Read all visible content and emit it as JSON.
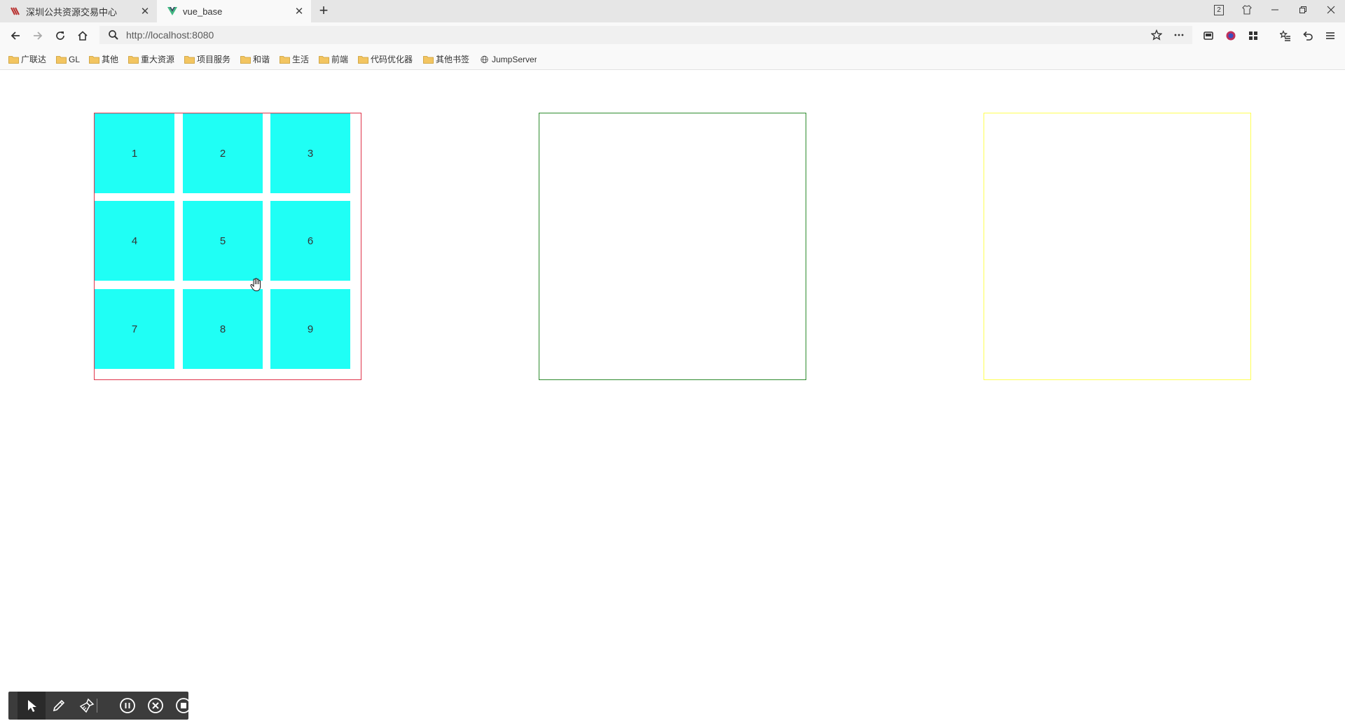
{
  "tabs": [
    {
      "title": "深圳公共资源交易中心",
      "favicon": "sz-logo-icon",
      "active": false
    },
    {
      "title": "vue_base",
      "favicon": "vue-logo-icon",
      "active": true
    }
  ],
  "new_tab_label": "+",
  "window": {
    "tab_count": "2"
  },
  "address": {
    "url": "http://localhost:8080"
  },
  "bookmarks": [
    {
      "label": "广联达",
      "icon": "folder-icon"
    },
    {
      "label": "GL",
      "icon": "folder-icon"
    },
    {
      "label": "其他",
      "icon": "folder-icon"
    },
    {
      "label": "重大资源",
      "icon": "folder-icon"
    },
    {
      "label": "项目服务",
      "icon": "folder-icon"
    },
    {
      "label": "和谐",
      "icon": "folder-icon"
    },
    {
      "label": "生活",
      "icon": "folder-icon"
    },
    {
      "label": "前端",
      "icon": "folder-icon"
    },
    {
      "label": "代码优化器",
      "icon": "folder-icon"
    },
    {
      "label": "其他书签",
      "icon": "folder-icon"
    },
    {
      "label": "JumpServer",
      "icon": "globe-icon"
    }
  ],
  "page": {
    "boxes": [
      {
        "name": "red-box",
        "border_color": "#e0344a"
      },
      {
        "name": "green-box",
        "border_color": "#2e8b2e"
      },
      {
        "name": "yellow-box",
        "border_color": "#ffff55"
      }
    ],
    "grid_items": [
      "1",
      "2",
      "3",
      "4",
      "5",
      "6",
      "7",
      "8",
      "9"
    ],
    "cell_color": "#1ffff5"
  },
  "recorder_toolbar": {
    "buttons": [
      "pointer-icon",
      "pen-icon",
      "brush-icon",
      "pause-icon",
      "cancel-icon",
      "stop-icon"
    ]
  }
}
